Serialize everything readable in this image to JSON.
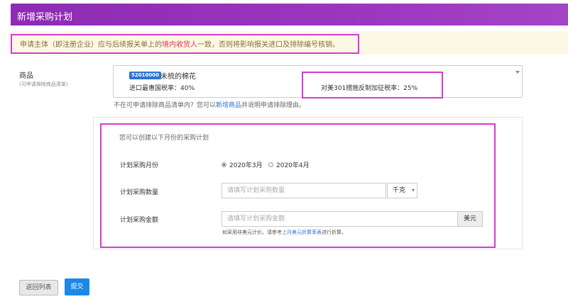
{
  "header": {
    "title": "新增采购计划"
  },
  "notice": {
    "text_before": "申请主体（即注册企业）应与后续报关单上的",
    "highlight": "境内收货人",
    "text_after": "一致，否则将影响报关进口及排除编号核销。"
  },
  "goods": {
    "label": "商品",
    "sublabel": "(可申请排除商品清单)",
    "hs_code": "52010000",
    "name": "未梳的棉花",
    "mfn_rate": "进口最惠国税率：40%",
    "tariff_rate": "对美301措施反制加征税率：25%"
  },
  "help": {
    "text_before": "不在可申请排除商品清单内？您可以",
    "link": "新增商品",
    "text_after": "并说明申请排除理由。"
  },
  "plan": {
    "heading": "您可以创建以下月份的采购计划",
    "month_label": "计划采购月份",
    "month_options": [
      {
        "label": "2020年3月",
        "checked": true
      },
      {
        "label": "2020年4月",
        "checked": false
      }
    ],
    "quantity_label": "计划采购数量",
    "quantity_placeholder": "请填写计划采购数量",
    "unit": "千克",
    "amount_label": "计划采购金额",
    "amount_placeholder": "请填写计划采购金额",
    "currency": "美元",
    "note_before": "如采用非美元计价，请参考",
    "note_link": "上月美元折算率表",
    "note_after": "进行折算。"
  },
  "actions": {
    "back": "返回列表",
    "submit": "提交"
  }
}
